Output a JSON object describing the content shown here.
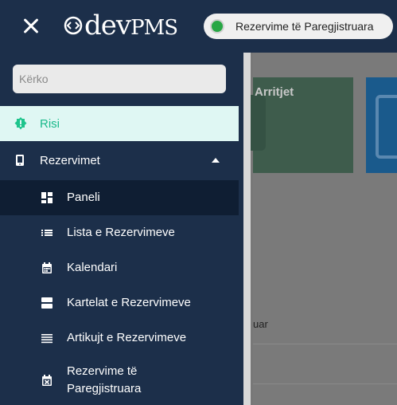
{
  "header": {
    "logo_text_dev": "dev",
    "logo_text_pms": "PMS",
    "status_label": "Rezervime të Paregjistruara",
    "status_color": "#28a745",
    "close_icon": "close-icon"
  },
  "sidebar": {
    "search_placeholder": "Kërko",
    "items": [
      {
        "label": "Risi",
        "icon": "alert-badge-icon",
        "active": true
      },
      {
        "label": "Rezervimet",
        "icon": "phone-icon",
        "expanded": true
      },
      {
        "label": "Paneli",
        "icon": "dashboard-icon",
        "selected": true
      },
      {
        "label": "Lista e Rezervimeve",
        "icon": "list-icon"
      },
      {
        "label": "Kalendari",
        "icon": "calendar-icon"
      },
      {
        "label": "Kartelat e Rezervimeve",
        "icon": "cards-icon"
      },
      {
        "label": "Artikujt e Rezervimeve",
        "icon": "lines-icon"
      },
      {
        "label": "Rezervime të Paregjistruara",
        "icon": "calendar-x-icon"
      }
    ]
  },
  "background": {
    "card_label": "Arritjet",
    "partial_text": "uar"
  }
}
